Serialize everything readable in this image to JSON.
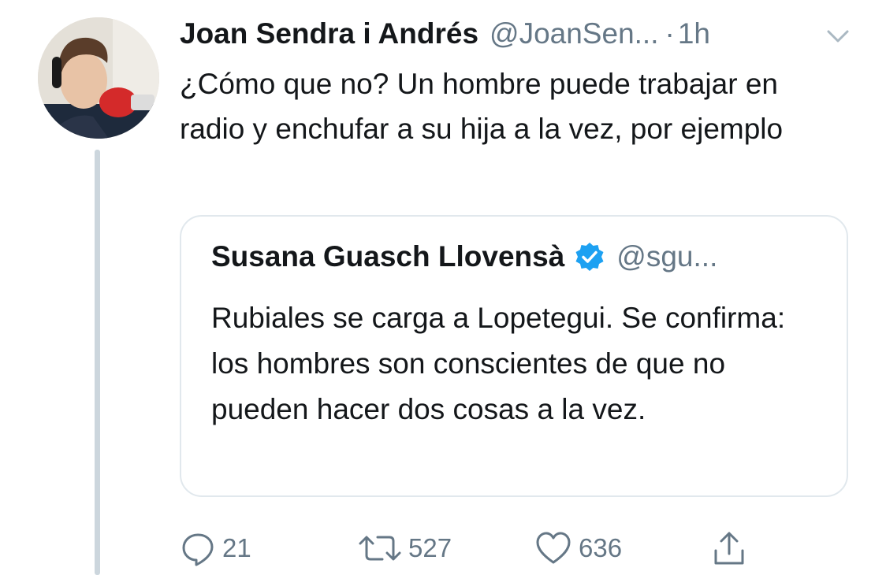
{
  "tweet": {
    "display_name": "Joan Sendra i Andrés",
    "handle": "@JoanSen...",
    "separator": "·",
    "time": "1h",
    "text": "¿Cómo que no? Un hombre puede trabajar en radio y enchufar a su hija a la vez, por ejemplo"
  },
  "quoted": {
    "display_name": "Susana Guasch Llovensà",
    "handle": "@sgu...",
    "verified": true,
    "text": "Rubiales se carga a Lopetegui. Se confirma: los hombres son conscientes de que no pueden hacer dos cosas a la vez."
  },
  "actions": {
    "reply_count": "21",
    "retweet_count": "527",
    "like_count": "636"
  },
  "icons": {
    "reply": "speech-bubble-icon",
    "retweet": "retweet-arrows-icon",
    "like": "heart-icon",
    "share": "share-upload-icon",
    "menu": "chevron-down-icon",
    "verified": "verified-badge-icon"
  },
  "colors": {
    "text": "#14171a",
    "secondary": "#657786",
    "verified": "#1da1f2",
    "border": "#e1e8ed",
    "thread_line": "#ccd6dd"
  }
}
